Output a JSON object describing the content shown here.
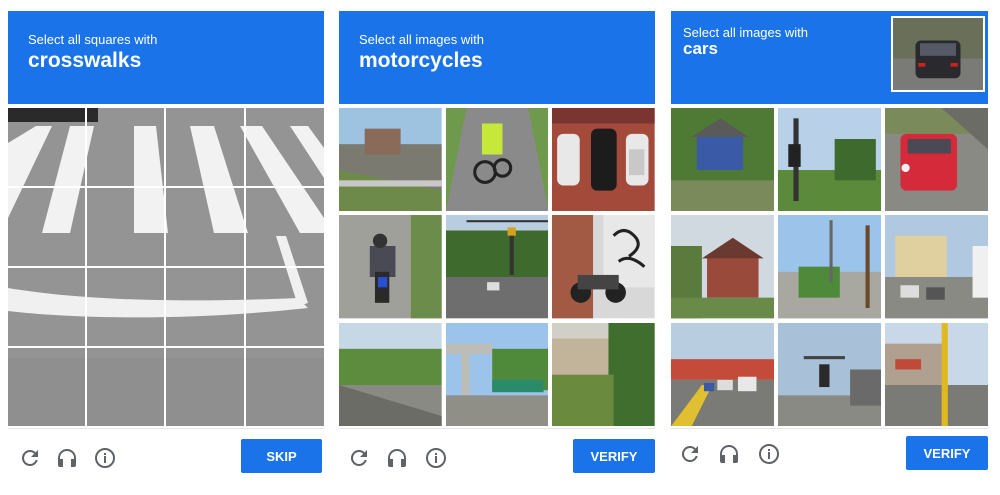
{
  "captchas": [
    {
      "instruction": "Select all squares with",
      "target": "crosswalks",
      "button_label": "SKIP",
      "footer_icons": [
        "reload-icon",
        "audio-icon",
        "info-icon"
      ]
    },
    {
      "instruction": "Select all images with",
      "target": "motorcycles",
      "button_label": "VERIFY",
      "footer_icons": [
        "reload-icon",
        "audio-icon",
        "info-icon"
      ]
    },
    {
      "instruction": "Select all images with",
      "target": "cars",
      "button_label": "VERIFY",
      "footer_icons": [
        "reload-icon",
        "audio-icon",
        "info-icon"
      ]
    }
  ],
  "colors": {
    "accent": "#1a73e8",
    "icon": "#5f6368"
  }
}
